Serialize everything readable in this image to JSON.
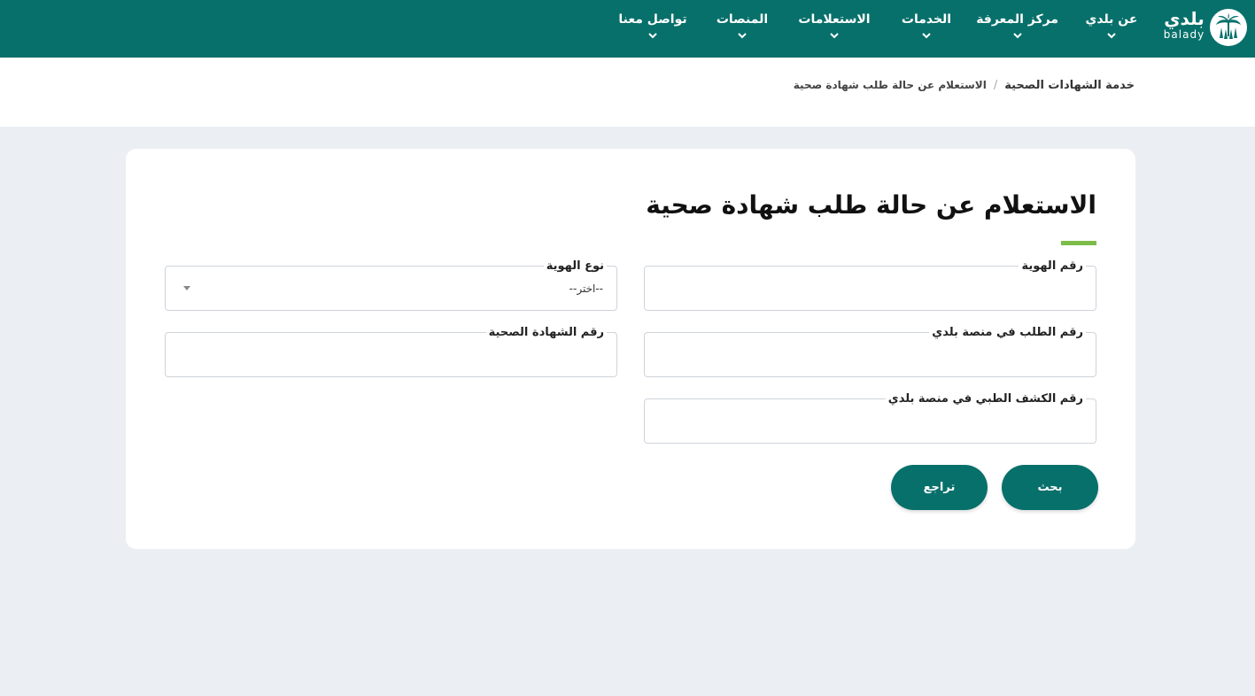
{
  "header": {
    "logo": {
      "arabic": "بلدي",
      "latin": "balady"
    },
    "nav": [
      {
        "id": "about",
        "label": "عن بلدي"
      },
      {
        "id": "knowledge",
        "label": "مركز المعرفة"
      },
      {
        "id": "services",
        "label": "الخدمات"
      },
      {
        "id": "inquiries",
        "label": "الاستعلامات"
      },
      {
        "id": "platforms",
        "label": "المنصات"
      },
      {
        "id": "contact",
        "label": "تواصل معنا"
      }
    ]
  },
  "breadcrumb": {
    "parent": "خدمة الشهادات الصحية",
    "separator": "/",
    "current": "الاستعلام عن حالة طلب شهادة صحية"
  },
  "form": {
    "title": "الاستعلام عن حالة طلب شهادة صحية",
    "fields": {
      "id_number": {
        "label": "رقم الهوية",
        "value": ""
      },
      "id_type": {
        "label": "نوع الهوية",
        "selected": "--اختر--"
      },
      "request_number": {
        "label": "رقم الطلب في منصة بلدي",
        "value": ""
      },
      "certificate_number": {
        "label": "رقم الشهادة الصحية",
        "value": ""
      },
      "medical_exam_number": {
        "label": "رقم الكشف الطبي في منصة بلدي",
        "value": ""
      }
    },
    "buttons": {
      "search": "بحث",
      "back": "تراجع"
    }
  },
  "colors": {
    "brand": "#08706b",
    "accent": "#7cbc4a",
    "page_background": "#ebeef2"
  },
  "icons": {
    "logo": "palm-tree-icon",
    "nav_chevron": "chevron-down-icon",
    "select_caret": "caret-down-icon"
  }
}
